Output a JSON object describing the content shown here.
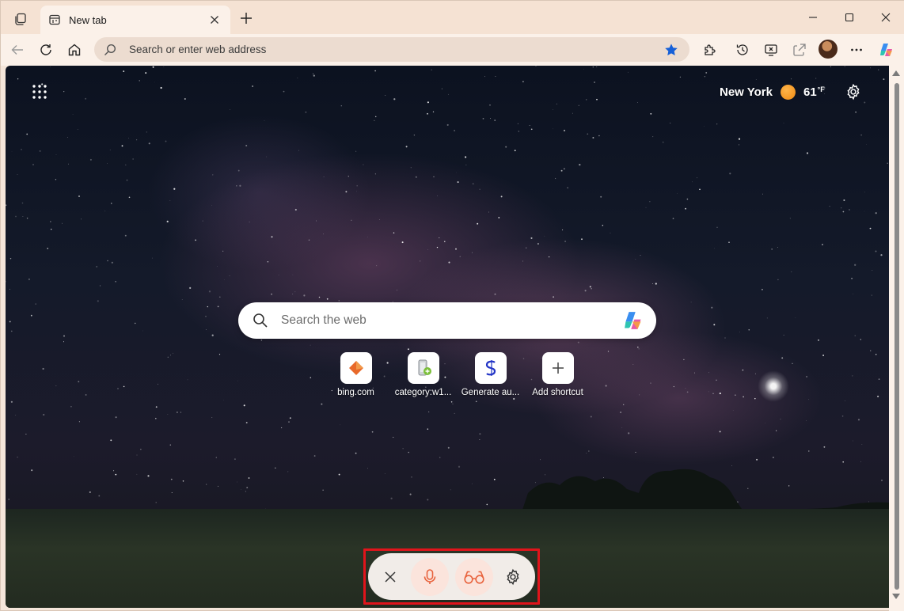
{
  "browser": {
    "tab": {
      "title": "New tab",
      "favicon": "new-tab-page-icon"
    },
    "window_controls": [
      "minimize",
      "maximize",
      "close"
    ],
    "address_bar": {
      "placeholder": "Search or enter web address",
      "value": ""
    },
    "toolbar_icons": [
      "back-icon",
      "refresh-icon",
      "home-icon",
      "favorite-star-icon",
      "extensions-icon",
      "history-icon",
      "screenshot-icon",
      "share-icon",
      "profile-avatar",
      "more-icon",
      "copilot-icon"
    ]
  },
  "newtab": {
    "weather": {
      "city": "New York",
      "temp": "61",
      "unit": "°F"
    },
    "search": {
      "placeholder": "Search the web"
    },
    "shortcuts": [
      {
        "label": "bing.com",
        "icon": "bing-icon"
      },
      {
        "label": "category:w1...",
        "icon": "jar-icon"
      },
      {
        "label": "Generate au...",
        "icon": "letter-s-icon"
      },
      {
        "label": "Add shortcut",
        "icon": "plus-icon"
      }
    ],
    "voice_bar": {
      "buttons": [
        "close-icon",
        "microphone-icon",
        "glasses-icon",
        "gear-icon"
      ],
      "highlight_color": "#e0141b",
      "accent_color": "#e8623c"
    }
  }
}
